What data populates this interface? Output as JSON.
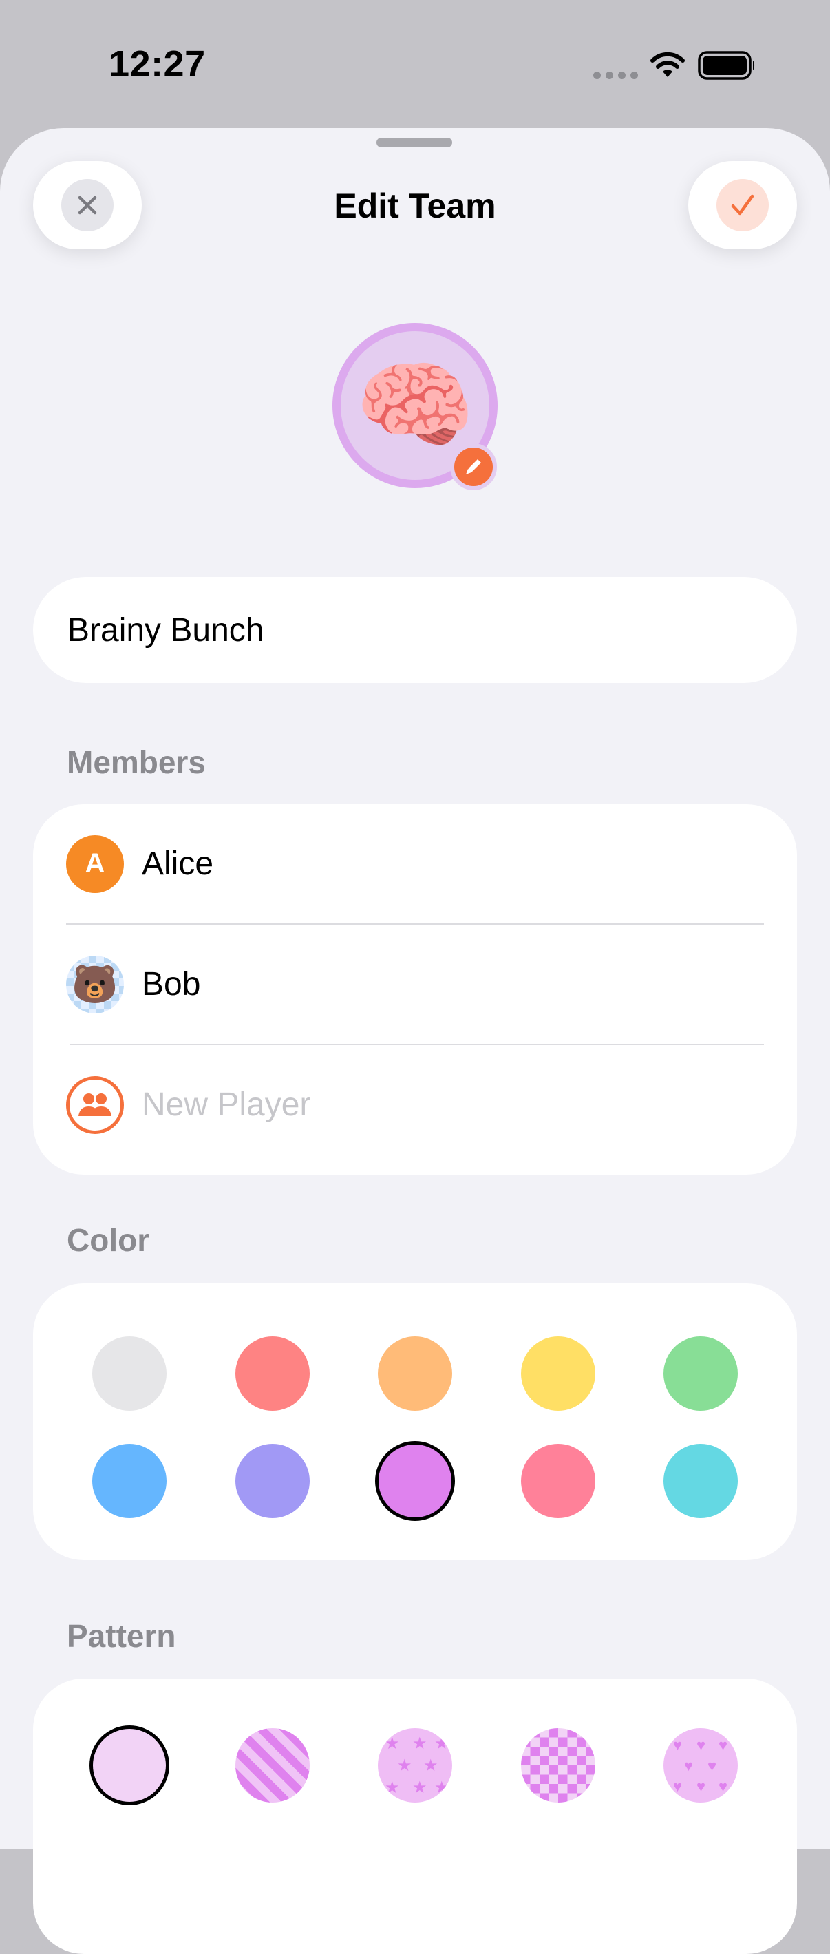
{
  "status_bar": {
    "time": "12:27"
  },
  "header": {
    "title": "Edit Team",
    "close_icon": "xmark-icon",
    "done_icon": "checkmark-icon"
  },
  "team": {
    "emoji": "🧠",
    "name": "Brainy Bunch",
    "edit_icon": "pencil-icon"
  },
  "members": {
    "label": "Members",
    "items": [
      {
        "initial": "A",
        "name": "Alice",
        "color": "#f68a25"
      },
      {
        "emoji": "🐻",
        "name": "Bob",
        "color": "#bcd9f5"
      }
    ],
    "new_player_placeholder": "New Player"
  },
  "color_section": {
    "label": "Color",
    "swatches": [
      "#e6e6e8",
      "#fe8383",
      "#ffbb78",
      "#ffdf65",
      "#88de96",
      "#65b6fe",
      "#a199f5",
      "#df82ee",
      "#ff8199",
      "#64d8e3"
    ],
    "selected_index": 7
  },
  "pattern_section": {
    "label": "Pattern",
    "patterns": [
      "solid",
      "stripes",
      "stars",
      "checkers",
      "hearts"
    ],
    "selected_index": 0
  },
  "colors": {
    "accent": "#f5703c",
    "sheet_bg": "#f2f2f7"
  }
}
